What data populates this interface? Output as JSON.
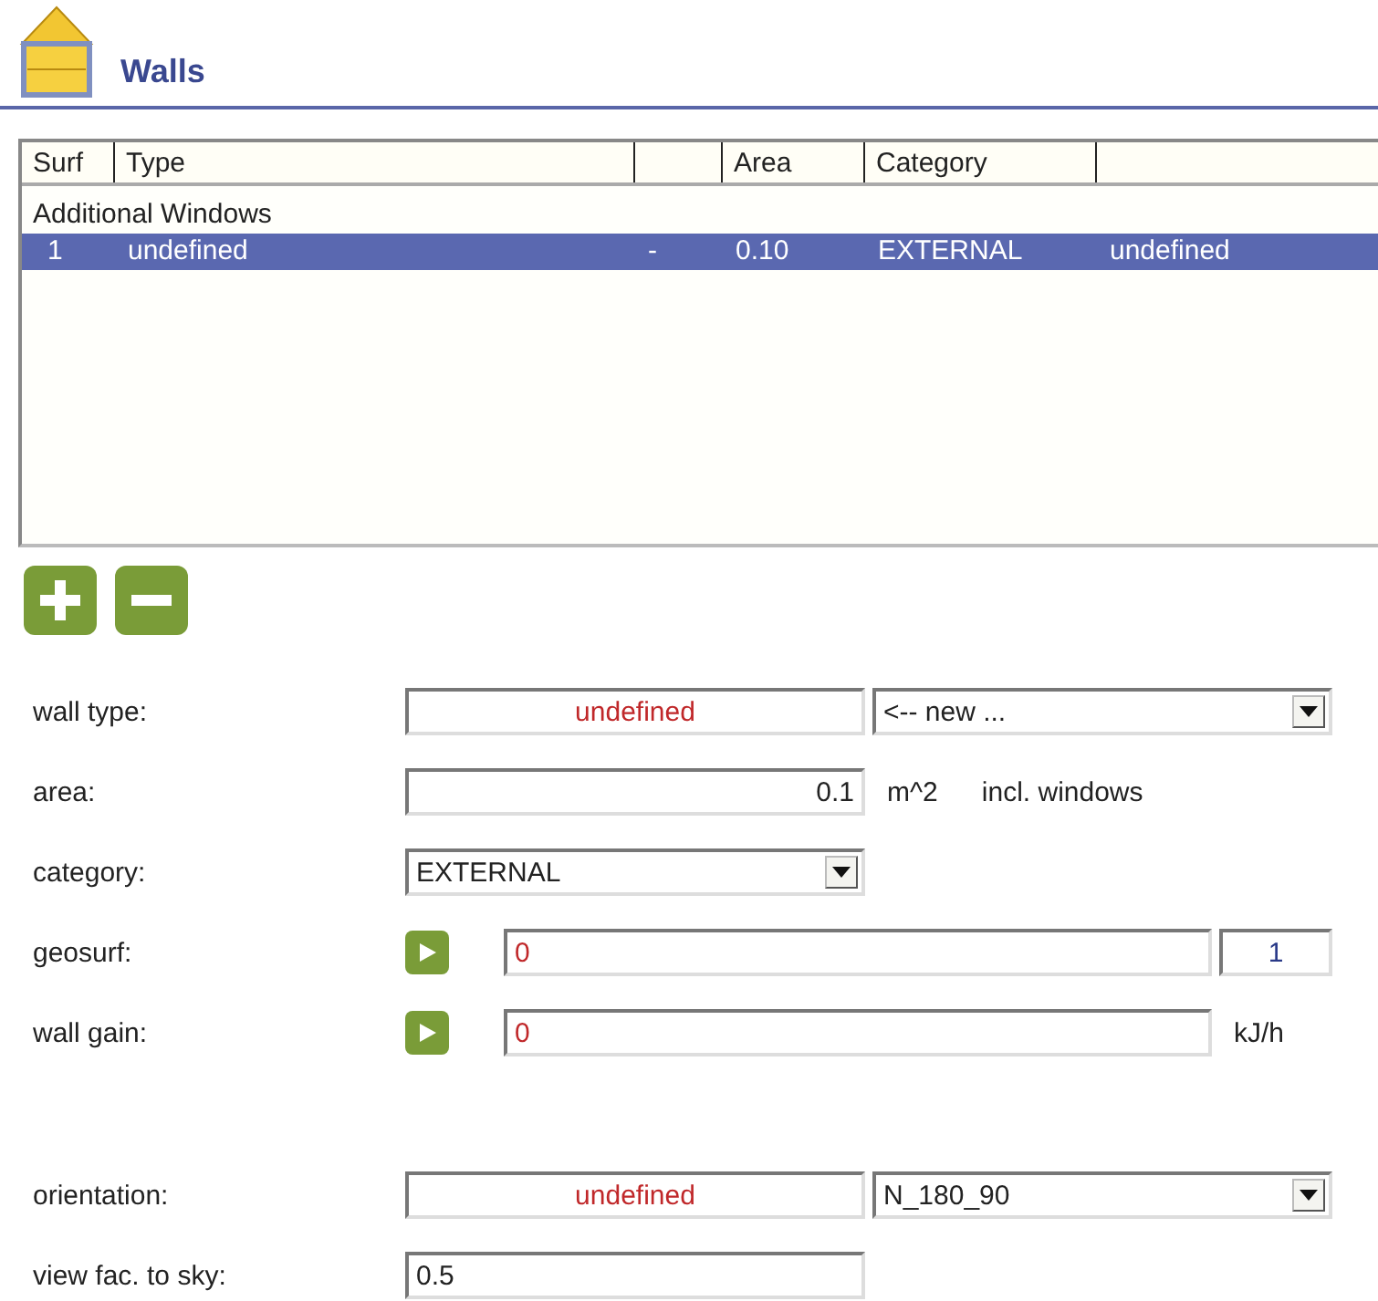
{
  "header": {
    "title": "Walls"
  },
  "list": {
    "columns": [
      {
        "label": "Surf"
      },
      {
        "label": "Type"
      },
      {},
      {
        "label": "Area"
      },
      {
        "label": "Category"
      },
      {}
    ],
    "groups": [
      {
        "title": "Additional Windows",
        "rows": [
          {
            "cells": [
              "1",
              "undefined",
              "-",
              "0.10",
              "EXTERNAL",
              "undefined"
            ],
            "selected": true
          }
        ]
      }
    ]
  },
  "form": [
    {
      "label": "wall type:",
      "main": {
        "kind": "display",
        "value": "undefined"
      },
      "side": {
        "kind": "combo",
        "value": "<-- new ..."
      }
    },
    {
      "label": "area:",
      "main": {
        "kind": "number",
        "value": "0.1"
      },
      "units": [
        "m^2",
        "incl. windows"
      ]
    },
    {
      "label": "category:",
      "main": {
        "kind": "combo",
        "value": "EXTERNAL"
      }
    },
    {
      "label": "geosurf:",
      "play": true,
      "main": {
        "kind": "linked",
        "value": "0"
      },
      "side": {
        "kind": "index",
        "value": "1"
      }
    },
    {
      "label": "wall gain:",
      "play": true,
      "main": {
        "kind": "linked",
        "value": "0"
      },
      "units": [
        "kJ/h"
      ]
    },
    {
      "kind": "gap"
    },
    {
      "label": "orientation:",
      "main": {
        "kind": "display",
        "value": "undefined"
      },
      "side": {
        "kind": "combo",
        "value": "N_180_90"
      }
    },
    {
      "label": "view fac. to sky:",
      "main": {
        "kind": "text",
        "value": "0.5"
      }
    }
  ]
}
